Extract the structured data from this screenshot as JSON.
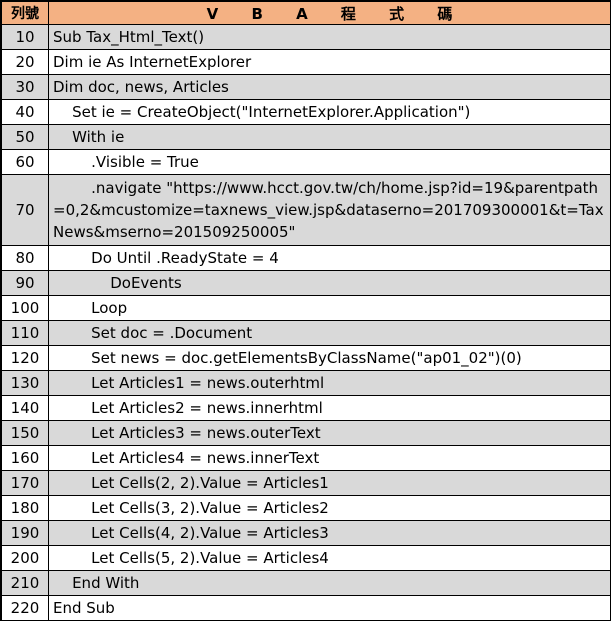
{
  "header": {
    "col_no": "列號",
    "col_code": "V B A 程 式 碼"
  },
  "rows": [
    {
      "no": "10",
      "code": "Sub Tax_Html_Text()"
    },
    {
      "no": "20",
      "code": "Dim ie As InternetExplorer"
    },
    {
      "no": "30",
      "code": "Dim doc, news, Articles"
    },
    {
      "no": "40",
      "code": "    Set ie = CreateObject(\"InternetExplorer.Application\")"
    },
    {
      "no": "50",
      "code": "    With ie"
    },
    {
      "no": "60",
      "code": "        .Visible = True"
    },
    {
      "no": "70",
      "code": "        .navigate \"https://www.hcct.gov.tw/ch/home.jsp?id=19&parentpath=0,2&mcustomize=taxnews_view.jsp&dataserno=201709300001&t=TaxNews&mserno=201509250005\""
    },
    {
      "no": "80",
      "code": "        Do Until .ReadyState = 4"
    },
    {
      "no": "90",
      "code": "            DoEvents"
    },
    {
      "no": "100",
      "code": "        Loop"
    },
    {
      "no": "110",
      "code": "        Set doc = .Document"
    },
    {
      "no": "120",
      "code": "        Set news = doc.getElementsByClassName(\"ap01_02\")(0)"
    },
    {
      "no": "130",
      "code": "        Let Articles1 = news.outerhtml"
    },
    {
      "no": "140",
      "code": "        Let Articles2 = news.innerhtml"
    },
    {
      "no": "150",
      "code": "        Let Articles3 = news.outerText"
    },
    {
      "no": "160",
      "code": "        Let Articles4 = news.innerText"
    },
    {
      "no": "170",
      "code": "        Let Cells(2, 2).Value = Articles1"
    },
    {
      "no": "180",
      "code": "        Let Cells(3, 2).Value = Articles2"
    },
    {
      "no": "190",
      "code": "        Let Cells(4, 2).Value = Articles3"
    },
    {
      "no": "200",
      "code": "        Let Cells(5, 2).Value = Articles4"
    },
    {
      "no": "210",
      "code": "    End With"
    },
    {
      "no": "220",
      "code": "End Sub"
    }
  ],
  "colors": {
    "header_bg": "#f4b183",
    "shade_bg": "#d9d9d9"
  }
}
